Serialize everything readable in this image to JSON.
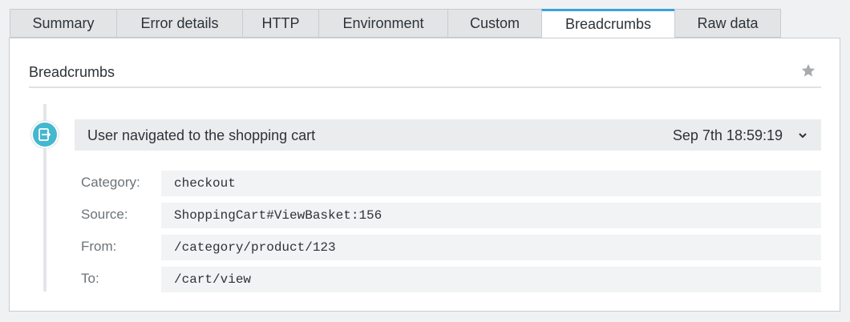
{
  "tabs": [
    {
      "label": "Summary"
    },
    {
      "label": "Error details"
    },
    {
      "label": "HTTP"
    },
    {
      "label": "Environment"
    },
    {
      "label": "Custom"
    },
    {
      "label": "Breadcrumbs",
      "active": true
    },
    {
      "label": "Raw data"
    }
  ],
  "panel": {
    "title": "Breadcrumbs",
    "star_icon": "star-icon"
  },
  "breadcrumb": {
    "icon": "navigation-icon",
    "message": "User navigated to the shopping cart",
    "timestamp": "Sep 7th 18:59:19",
    "details": [
      {
        "label": "Category:",
        "value": "checkout"
      },
      {
        "label": "Source:",
        "value": "ShoppingCart#ViewBasket:156"
      },
      {
        "label": "From:",
        "value": "/category/product/123"
      },
      {
        "label": "To:",
        "value": "/cart/view"
      }
    ]
  },
  "colors": {
    "accent": "#3aa3d8",
    "icon_bg": "#43b8cf"
  }
}
